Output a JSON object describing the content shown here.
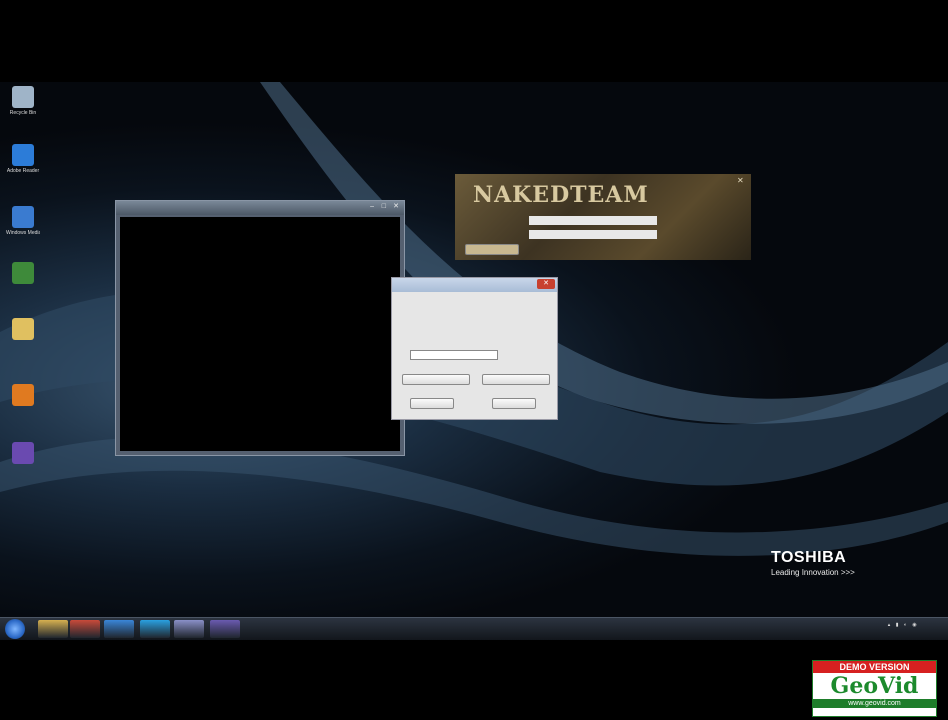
{
  "desktop": {
    "icons": [
      {
        "label": "Recycle Bin",
        "icon": "recycle-bin-icon",
        "color": "#9fb4c8"
      },
      {
        "label": "Adobe Reader",
        "icon": "app-icon",
        "color": "#2c7cd8"
      },
      {
        "label": "Windows Media",
        "icon": "media-player-icon",
        "color": "#3a7bd0"
      },
      {
        "label": "",
        "icon": "game-icon",
        "color": "#3e8a3a"
      },
      {
        "label": "",
        "icon": "folder-icon",
        "color": "#e0c060"
      },
      {
        "label": "",
        "icon": "photo-icon",
        "color": "#e07a20"
      },
      {
        "label": "",
        "icon": "uninstall-icon",
        "color": "#6a4ab0"
      }
    ]
  },
  "console_window": {
    "title": ""
  },
  "keygen": {
    "logo": "NAKEDTEAM",
    "field_1_label": "",
    "field_1_value": "",
    "field_2_label": "",
    "field_2_value": ""
  },
  "dialog": {
    "title": "",
    "link_text": "",
    "ok_label": "",
    "cancel_label": "",
    "left_button_label": "",
    "right_button_label": ""
  },
  "taskbar": {
    "time": "",
    "date": "",
    "pinned": [
      {
        "icon": "explorer-icon",
        "color": "#d6b050"
      },
      {
        "icon": "chrome-icon",
        "color": "#c84a3a"
      },
      {
        "icon": "ie-icon",
        "color": "#3a86d8"
      },
      {
        "icon": "skype-icon",
        "color": "#2aa0e0"
      },
      {
        "icon": "app-window-icon",
        "color": "#8a90c8"
      },
      {
        "icon": "app-window-icon",
        "color": "#6a5ab0"
      }
    ]
  },
  "brand": {
    "name": "TOSHIBA",
    "tagline": "Leading Innovation >>>"
  },
  "watermark": {
    "demo": "DEMO VERSION",
    "name": "GeoVid",
    "url": "www.geovid.com"
  }
}
